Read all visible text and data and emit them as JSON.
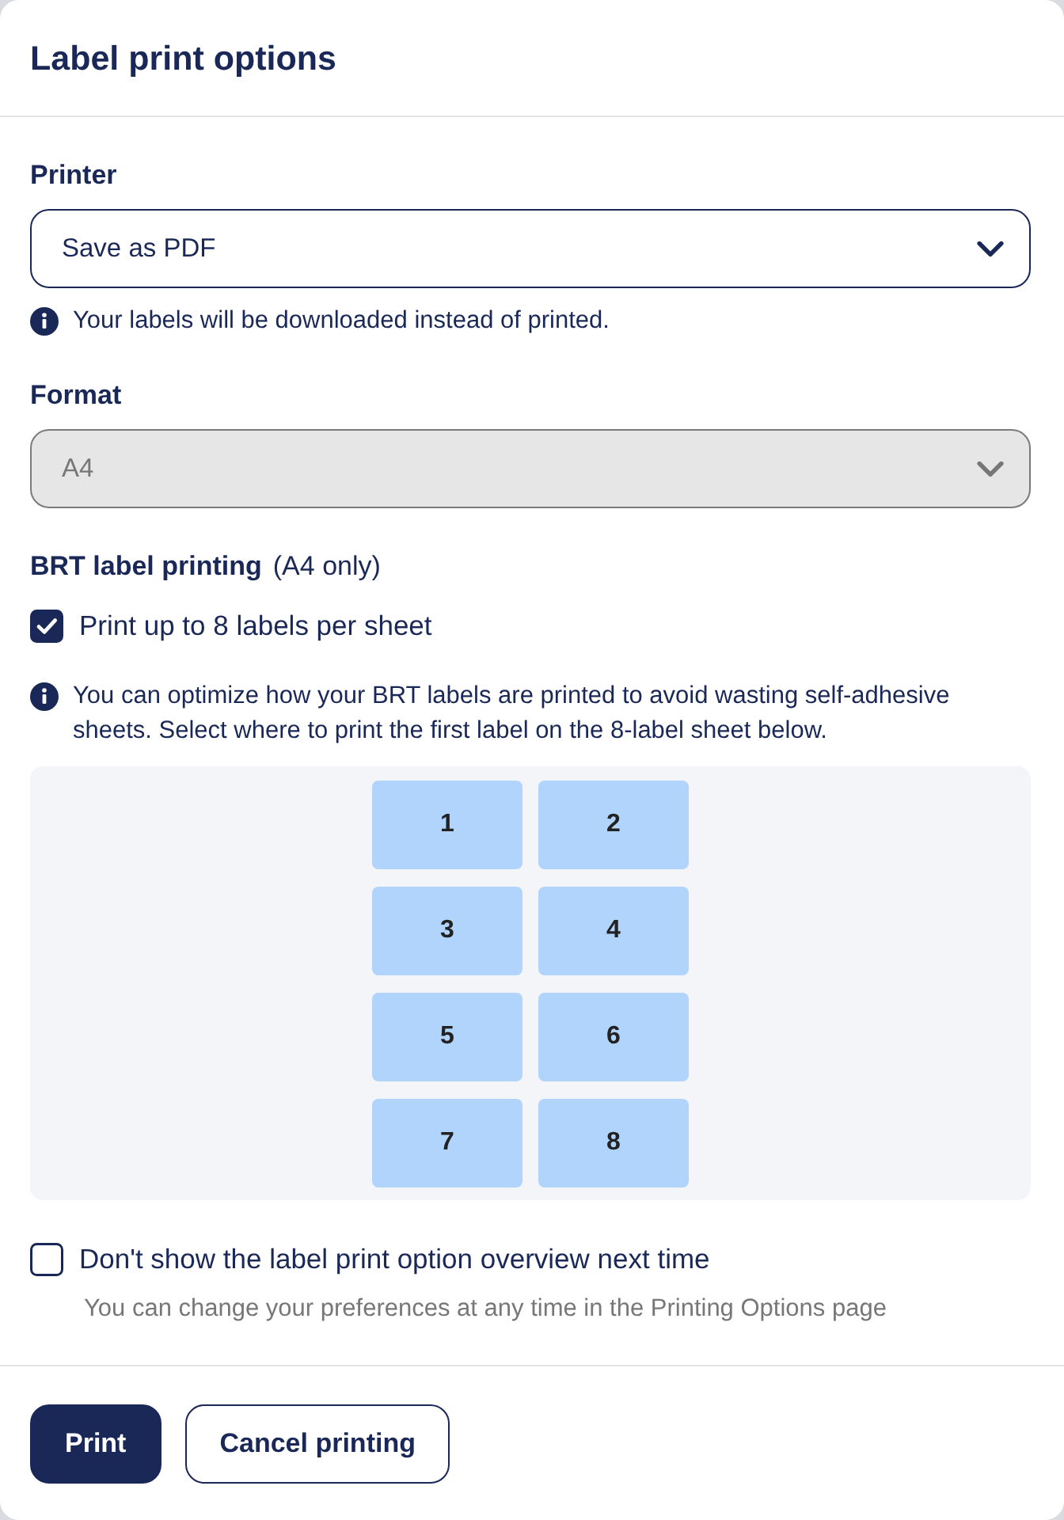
{
  "dialog": {
    "title": "Label print options"
  },
  "printer": {
    "label": "Printer",
    "value": "Save as PDF",
    "disabled": false,
    "note": "Your labels will be downloaded instead of printed."
  },
  "format": {
    "label": "Format",
    "value": "A4",
    "disabled": true
  },
  "brt": {
    "heading": "BRT label printing",
    "qualifier": "(A4 only)",
    "option": {
      "label": "Print up to 8 labels per sheet",
      "checked": true
    },
    "note": "You can optimize how your BRT labels are printed to avoid wasting self-adhesive sheets. Select where to print the first label on the 8-label sheet below.",
    "positions": [
      "1",
      "2",
      "3",
      "4",
      "5",
      "6",
      "7",
      "8"
    ]
  },
  "dont_show": {
    "label": "Don't show the label print option overview next time",
    "checked": false,
    "hint": "You can change your preferences at any time in the Printing Options page"
  },
  "buttons": [
    {
      "label": "Print",
      "kind": "primary"
    },
    {
      "label": "Cancel printing",
      "kind": "secondary"
    }
  ]
}
